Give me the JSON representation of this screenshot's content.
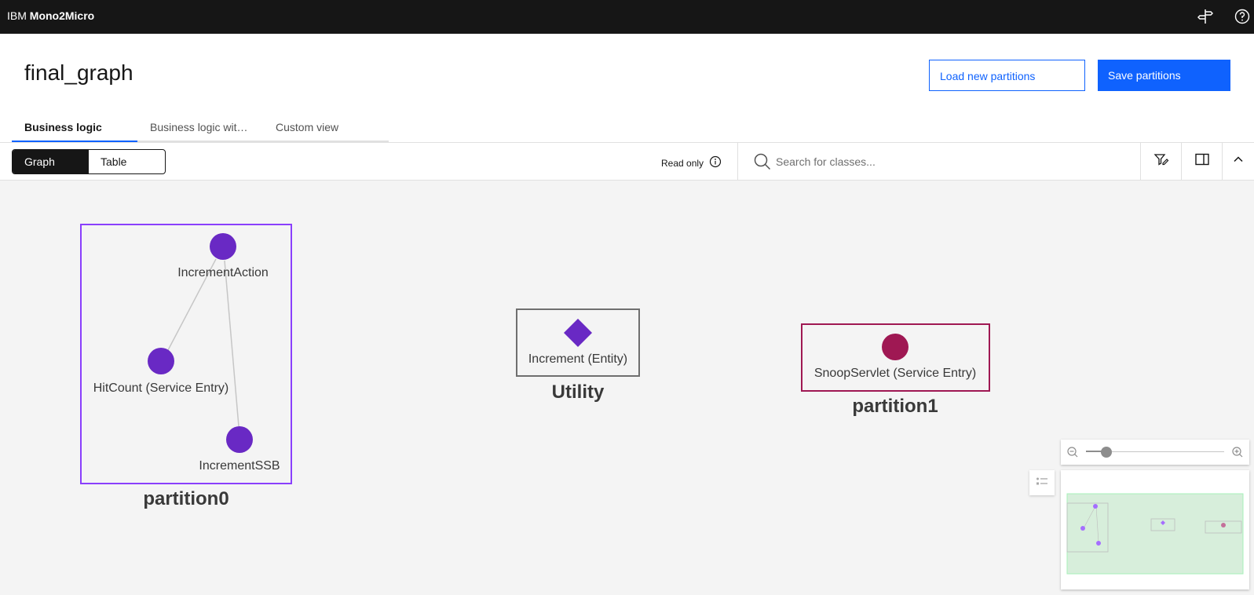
{
  "app": {
    "brand_prefix": "IBM",
    "brand_name": "Mono2Micro"
  },
  "header": {
    "title": "final_graph",
    "load_button": "Load new partitions",
    "save_button": "Save partitions"
  },
  "tabs": [
    {
      "label": "Business logic",
      "active": true
    },
    {
      "label": "Business logic wit…",
      "active": false
    },
    {
      "label": "Custom view",
      "active": false
    }
  ],
  "toolbar": {
    "view_options": [
      "Graph",
      "Table"
    ],
    "selected_view": "Graph",
    "read_only_label": "Read only",
    "search_placeholder": "Search for classes..."
  },
  "graph": {
    "partitions": [
      {
        "name": "partition0",
        "color": "#8a3ffc",
        "nodes": [
          {
            "label": "IncrementAction",
            "shape": "circle"
          },
          {
            "label": "HitCount (Service Entry)",
            "shape": "circle"
          },
          {
            "label": "IncrementSSB",
            "shape": "circle"
          }
        ]
      },
      {
        "name": "Utility",
        "color": "#525252",
        "nodes": [
          {
            "label": "Increment (Entity)",
            "shape": "diamond"
          }
        ]
      },
      {
        "name": "partition1",
        "color": "#9f1853",
        "nodes": [
          {
            "label": "SnoopServlet (Service Entry)",
            "shape": "circle"
          }
        ]
      }
    ],
    "node_color_primary": "#6929c4",
    "node_color_secondary": "#9f1853"
  },
  "minimap": {
    "zoom_fraction": 0.15
  }
}
